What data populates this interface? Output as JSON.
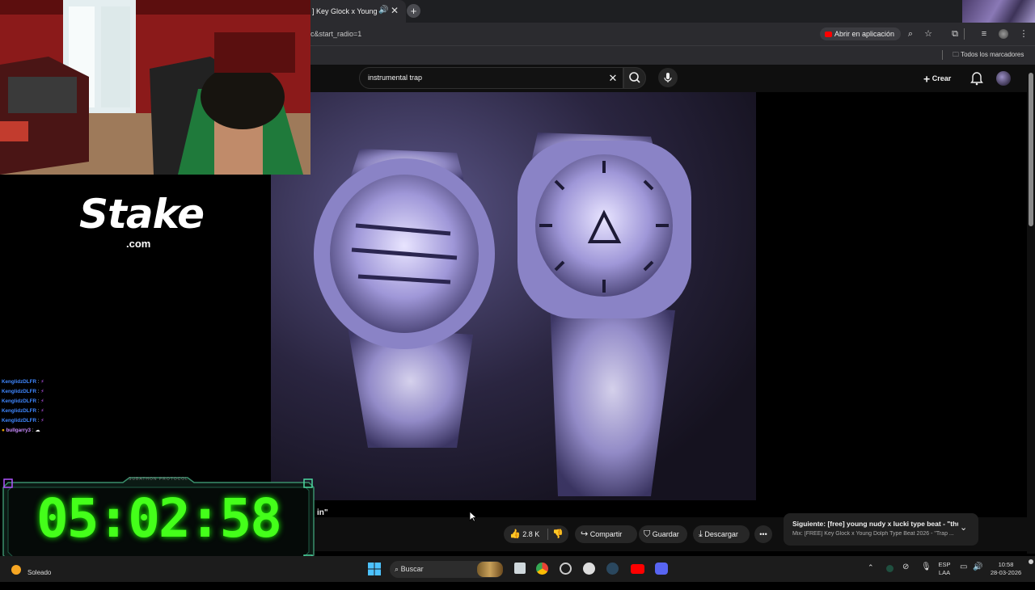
{
  "browser": {
    "tab_title": "] Key Glock x Young",
    "new_tab_label": "+",
    "url": "c&start_radio=1",
    "open_app_label": "Abrir en aplicación",
    "bookmarks_all_label": "Todos los marcadores"
  },
  "youtube": {
    "search_value": "instrumental trap",
    "create_label": "Crear",
    "title_fragment": "in\"",
    "likes": "2.8 K",
    "share_label": "Compartir",
    "save_label": "Guardar",
    "download_label": "Descargar",
    "next_title": "Siguiente: [free] young nudy x lucki type beat - \"thun...",
    "next_subtitle": "Mix: [FREE] Key Glock x Young Dolph Type Beat 2026 - \"Trap ..."
  },
  "overlay": {
    "stake_logo": "Stake",
    "stake_domain": ".com",
    "timer_label": "SUBATHON PROTOCOL",
    "timer": "05:02:58",
    "chat": [
      {
        "user": "KenglidzDLFR",
        "sep": ":",
        "msg": "",
        "color": "#3f87ff"
      },
      {
        "user": "KenglidzDLFR",
        "sep": ":",
        "msg": "",
        "color": "#3f87ff"
      },
      {
        "user": "KenglidzDLFR",
        "sep": ":",
        "msg": "",
        "color": "#3f87ff"
      },
      {
        "user": "KenglidzDLFR",
        "sep": ":",
        "msg": "",
        "color": "#3f87ff"
      },
      {
        "user": "KenglidzDLFR",
        "sep": ":",
        "msg": "",
        "color": "#3f87ff"
      },
      {
        "user": "bullgarry3",
        "sep": ":",
        "msg": "",
        "color": "#c98bff"
      }
    ]
  },
  "taskbar": {
    "weather": "Soleado",
    "search_label": "Buscar",
    "lang_top": "ESP",
    "lang_bottom": "LAA",
    "time": "10:58",
    "date": "28-03-2026"
  }
}
